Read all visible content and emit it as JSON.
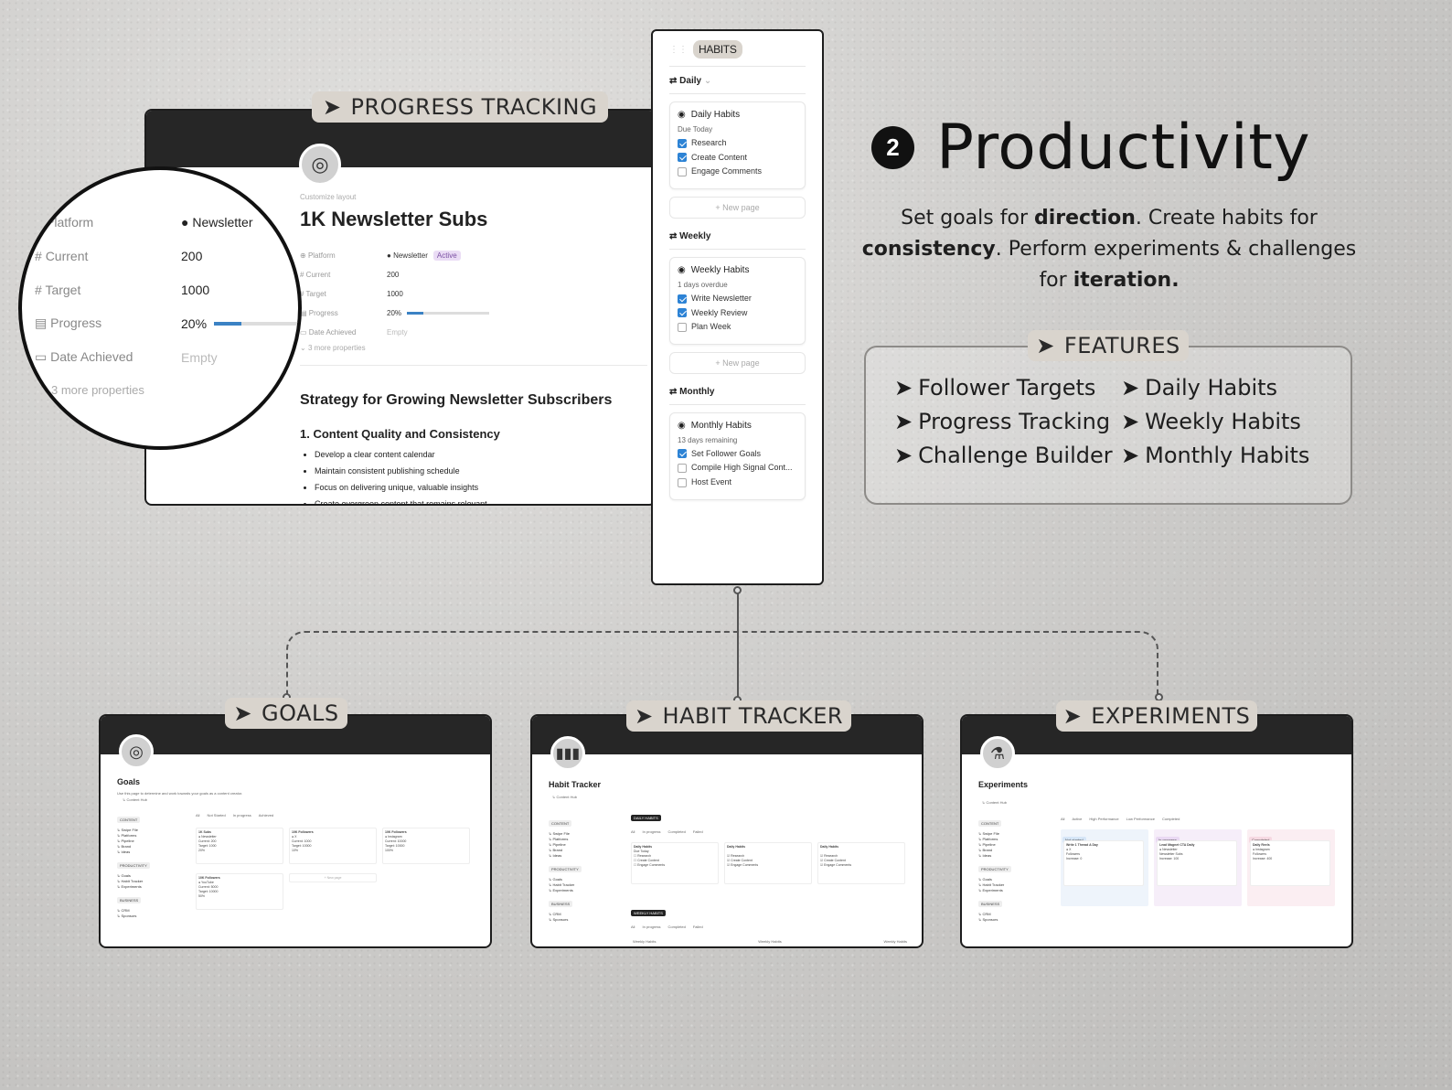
{
  "headline": {
    "badge": "2",
    "title": "Productivity"
  },
  "tagline": [
    {
      "text": "Set goals for ",
      "bold": false
    },
    {
      "text": "direction",
      "bold": true
    },
    {
      "text": ". Create habits for ",
      "bold": false
    },
    {
      "text": "consistency",
      "bold": true
    },
    {
      "text": ". Perform experiments & challenges for ",
      "bold": false
    },
    {
      "text": "iteration.",
      "bold": true
    }
  ],
  "features": {
    "label": "FEATURES",
    "items": [
      "Follower Targets",
      "Daily Habits",
      "Progress Tracking",
      "Weekly Habits",
      "Challenge Builder",
      "Monthly Habits"
    ]
  },
  "progress": {
    "label": "PROGRESS TRACKING",
    "customize": "Customize layout",
    "title": "1K Newsletter Subs",
    "props": [
      {
        "name": "Platform",
        "value": "Newsletter",
        "badge": "Active"
      },
      {
        "name": "Current",
        "value": "200"
      },
      {
        "name": "Target",
        "value": "1000"
      },
      {
        "name": "Progress",
        "value": "20%",
        "fill": 0.2
      },
      {
        "name": "Date Achieved",
        "value": "Empty"
      }
    ],
    "more": "3 more properties",
    "heading": "Strategy for Growing Newsletter Subscribers",
    "subheading": "1. Content Quality and Consistency",
    "bullets": [
      "Develop a clear content calendar",
      "Maintain consistent publishing schedule",
      "Focus on delivering unique, valuable insights",
      "Create evergreen content that remains relevant"
    ]
  },
  "zoom": {
    "props": [
      {
        "name": "Platform",
        "value": "Newsletter"
      },
      {
        "name": "Current",
        "value": "200"
      },
      {
        "name": "Target",
        "value": "1000"
      },
      {
        "name": "Progress",
        "value": "20%",
        "fill": 0.2
      },
      {
        "name": "Date Achieved",
        "value": "Empty"
      }
    ],
    "more": "3 more properties"
  },
  "habits": {
    "tag": "HABITS",
    "new_page": "New page",
    "groups": [
      {
        "name": "Daily",
        "card": "Daily Habits",
        "status": "Due Today",
        "tasks": [
          {
            "t": "Research",
            "on": true
          },
          {
            "t": "Create Content",
            "on": true
          },
          {
            "t": "Engage Comments",
            "on": false
          }
        ]
      },
      {
        "name": "Weekly",
        "card": "Weekly Habits",
        "status": "1 days overdue",
        "tasks": [
          {
            "t": "Write Newsletter",
            "on": true
          },
          {
            "t": "Weekly Review",
            "on": true
          },
          {
            "t": "Plan Week",
            "on": false
          }
        ]
      },
      {
        "name": "Monthly",
        "card": "Monthly Habits",
        "status": "13 days remaining",
        "tasks": [
          {
            "t": "Set Follower Goals",
            "on": true
          },
          {
            "t": "Compile High Signal Cont...",
            "on": false
          },
          {
            "t": "Host Event",
            "on": false
          }
        ]
      }
    ]
  },
  "panels": [
    {
      "label": "GOALS",
      "title": "Goals",
      "icon": "target-icon"
    },
    {
      "label": "HABIT TRACKER",
      "title": "Habit Tracker",
      "icon": "bar-chart-icon"
    },
    {
      "label": "EXPERIMENTS",
      "title": "Experiments",
      "icon": "test-tube-icon"
    }
  ],
  "mini": {
    "desc": "Use this page to determine and work towards your goals as a content creator.",
    "hub": "Content Hub",
    "sections": [
      "CONTENT",
      "PRODUCTIVITY",
      "BUSINESS"
    ],
    "side1": [
      "Swipe File",
      "Platforms",
      "Pipeline",
      "Brand",
      "Ideas"
    ],
    "side2": [
      "Goals",
      "Habit Tracker",
      "Experiments"
    ],
    "side3": [
      "CRM",
      "Sponsors"
    ],
    "goal_tabs": [
      "All",
      "Not Started",
      "In progress",
      "Achieved"
    ],
    "goal_cards": [
      {
        "t": "1K Subs",
        "p": "Newsletter",
        "c": "Current: 200",
        "g": "Target: 1000",
        "v": "20%"
      },
      {
        "t": "10K Followers",
        "p": "X",
        "c": "Current: 1000",
        "g": "Target: 10000",
        "v": "10%"
      },
      {
        "t": "10K Followers",
        "p": "Instagram",
        "c": "Current: 10000",
        "g": "Target: 10000",
        "v": "100%"
      },
      {
        "t": "10K Followers",
        "p": "YouTube",
        "c": "Current: 5000",
        "g": "Target: 10000",
        "v": "50%"
      }
    ],
    "habit_tabs": [
      "All",
      "In progress",
      "Completed",
      "Failed"
    ],
    "daily_tag": "DAILY HABITS",
    "weekly_tag": "WEEKLY HABITS",
    "exp_tabs": [
      "All",
      "Active",
      "High Performance",
      "Low Performance",
      "Completed"
    ],
    "exp_cols": [
      "Not started",
      "In progress",
      "Completed"
    ],
    "exp_cards": [
      {
        "t": "Write 1 Thread A Day",
        "p": "X",
        "m": "Followers",
        "r": "Increase: 0"
      },
      {
        "t": "Lead Magnet CTA Daily",
        "p": "Newsletter",
        "m": "Newsletter Subs",
        "r": "Increase: 100"
      },
      {
        "t": "Daily Reels",
        "p": "Instagram",
        "m": "Followers",
        "r": "Increase: 400"
      }
    ]
  }
}
